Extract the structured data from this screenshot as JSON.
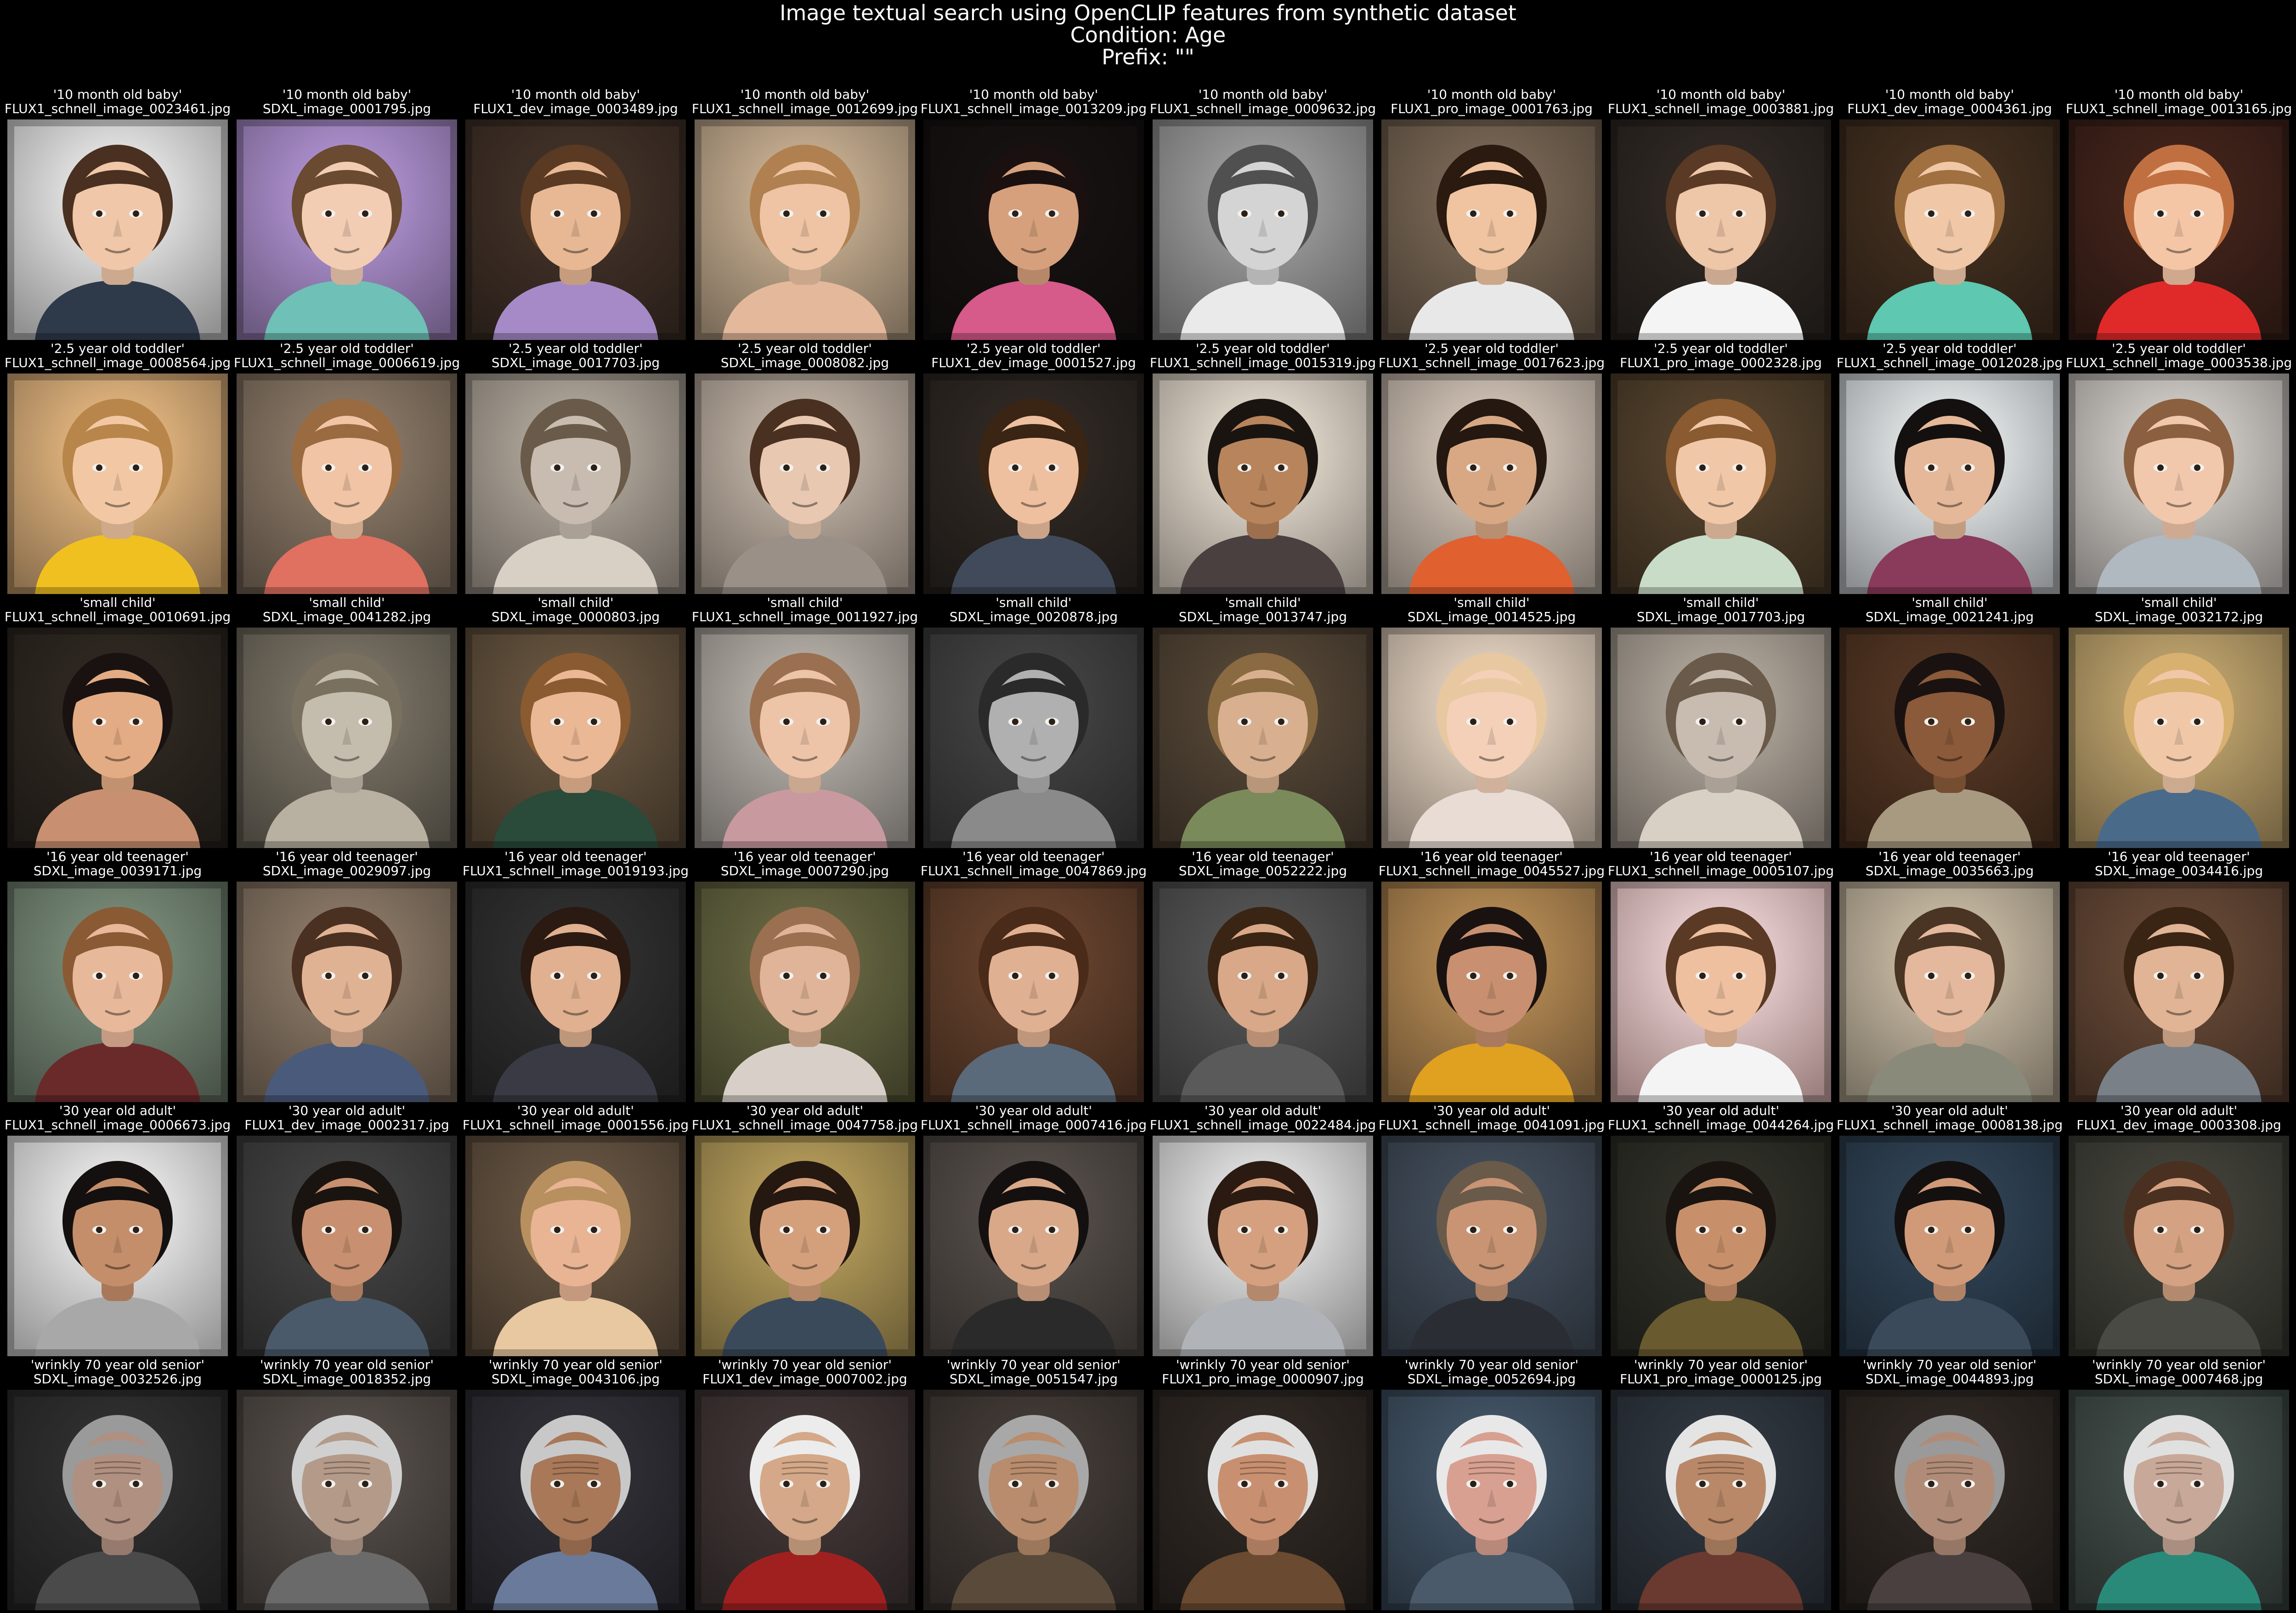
{
  "figure": {
    "title_lines": [
      "Image textual search using OpenCLIP features from synthetic dataset",
      "Condition: Age",
      "Prefix: \"\""
    ]
  },
  "rows": [
    {
      "query": "'10 month old baby'",
      "images": [
        {
          "file": "FLUX1_schnell_image_0023461.jpg",
          "bg": "#cfcfcf",
          "skin": "#f0c7a8",
          "hair": "#4a3020",
          "cloth": "#2e3a4a"
        },
        {
          "file": "SDXL_image_0001795.jpg",
          "bg": "#9a80b8",
          "skin": "#f2cdb4",
          "hair": "#6a4a30",
          "cloth": "#6fc0b6"
        },
        {
          "file": "FLUX1_dev_image_0003489.jpg",
          "bg": "#3a2c24",
          "skin": "#e8b894",
          "hair": "#5a3a22",
          "cloth": "#a68ac8"
        },
        {
          "file": "FLUX1_schnell_image_0012699.jpg",
          "bg": "#b09a80",
          "skin": "#eec4a4",
          "hair": "#b08050",
          "cloth": "#e4b89a"
        },
        {
          "file": "FLUX1_schnell_image_0013209.jpg",
          "bg": "#141010",
          "skin": "#d6a07c",
          "hair": "#1a1010",
          "cloth": "#d65a8a"
        },
        {
          "file": "FLUX1_schnell_image_0009632.jpg",
          "bg": "#8a8a8a",
          "skin": "#d4d4d4",
          "hair": "#505050",
          "cloth": "#eaeaea"
        },
        {
          "file": "FLUX1_pro_image_0001763.jpg",
          "bg": "#6a5a4a",
          "skin": "#f0c4a0",
          "hair": "#2a1a10",
          "cloth": "#e8e8e8"
        },
        {
          "file": "FLUX1_schnell_image_0003881.jpg",
          "bg": "#2a2420",
          "skin": "#eec6a8",
          "hair": "#5a3a24",
          "cloth": "#f4f4f4"
        },
        {
          "file": "FLUX1_dev_image_0004361.jpg",
          "bg": "#3a2a1c",
          "skin": "#f0c8a8",
          "hair": "#a07040",
          "cloth": "#5ec8b0"
        },
        {
          "file": "FLUX1_schnell_image_0013165.jpg",
          "bg": "#3a2018",
          "skin": "#f4c6a6",
          "hair": "#c07040",
          "cloth": "#e02a2a"
        }
      ]
    },
    {
      "query": "'2.5 year old toddler'",
      "images": [
        {
          "file": "FLUX1_schnell_image_0008564.jpg",
          "bg": "#c8a070",
          "skin": "#f2c8a4",
          "hair": "#b8864a",
          "cloth": "#f0c020"
        },
        {
          "file": "FLUX1_schnell_image_0006619.jpg",
          "bg": "#7a6a5a",
          "skin": "#f0c4a4",
          "hair": "#9a6a40",
          "cloth": "#e07060"
        },
        {
          "file": "SDXL_image_0017703.jpg",
          "bg": "#9a9288",
          "skin": "#c8bcb0",
          "hair": "#6a5a4a",
          "cloth": "#d8d0c4"
        },
        {
          "file": "SDXL_image_0008082.jpg",
          "bg": "#a89c90",
          "skin": "#e8c8b0",
          "hair": "#4a3020",
          "cloth": "#9a9088"
        },
        {
          "file": "FLUX1_dev_image_0001527.jpg",
          "bg": "#2a2420",
          "skin": "#eec0a0",
          "hair": "#3a2414",
          "cloth": "#404a5a"
        },
        {
          "file": "FLUX1_schnell_image_0015319.jpg",
          "bg": "#c8c0b4",
          "skin": "#b8845c",
          "hair": "#1a1410",
          "cloth": "#4a4040"
        },
        {
          "file": "FLUX1_schnell_image_0017623.jpg",
          "bg": "#b8aca0",
          "skin": "#d8a884",
          "hair": "#241810",
          "cloth": "#e06030"
        },
        {
          "file": "FLUX1_pro_image_0002328.jpg",
          "bg": "#4a3a28",
          "skin": "#f0c8a8",
          "hair": "#8a5a30",
          "cloth": "#c8dcc8"
        },
        {
          "file": "FLUX1_schnell_image_0012028.jpg",
          "bg": "#c8ccd0",
          "skin": "#e4b898",
          "hair": "#141010",
          "cloth": "#8a3a5a"
        },
        {
          "file": "FLUX1_schnell_image_0003538.jpg",
          "bg": "#b8b4b0",
          "skin": "#f2c8ac",
          "hair": "#8a6040",
          "cloth": "#b0b8c0"
        }
      ]
    },
    {
      "query": "'small child'",
      "images": [
        {
          "file": "FLUX1_schnell_image_0010691.jpg",
          "bg": "#2a241e",
          "skin": "#e4ac84",
          "hair": "#1a1210",
          "cloth": "#c89070"
        },
        {
          "file": "SDXL_image_0041282.jpg",
          "bg": "#6a6458",
          "skin": "#c4bcac",
          "hair": "#7a7060",
          "cloth": "#b8b0a0"
        },
        {
          "file": "SDXL_image_0000803.jpg",
          "bg": "#5a4a38",
          "skin": "#eab894",
          "hair": "#8a5a30",
          "cloth": "#2a4a3a"
        },
        {
          "file": "FLUX1_schnell_image_0011927.jpg",
          "bg": "#a09a94",
          "skin": "#eec4a8",
          "hair": "#9a7050",
          "cloth": "#c89aa0"
        },
        {
          "file": "SDXL_image_0020878.jpg",
          "bg": "#3a3a3a",
          "skin": "#b0b0b0",
          "hair": "#2a2a2a",
          "cloth": "#8a8a8a"
        },
        {
          "file": "SDXL_image_0013747.jpg",
          "bg": "#4a3e30",
          "skin": "#d8b090",
          "hair": "#8a6a40",
          "cloth": "#7a8a5a"
        },
        {
          "file": "SDXL_image_0014525.jpg",
          "bg": "#c8b8a8",
          "skin": "#f4d0b8",
          "hair": "#e8c8a0",
          "cloth": "#e8dcd4"
        },
        {
          "file": "SDXL_image_0017703.jpg",
          "bg": "#9a9288",
          "skin": "#c8bcb0",
          "hair": "#6a5a4a",
          "cloth": "#d8d0c4"
        },
        {
          "file": "SDXL_image_0021241.jpg",
          "bg": "#4a3020",
          "skin": "#8a5a3a",
          "hair": "#1a1210",
          "cloth": "#a89a80"
        },
        {
          "file": "SDXL_image_0032172.jpg",
          "bg": "#a89060",
          "skin": "#f0c8a8",
          "hair": "#d8b070",
          "cloth": "#4a6a8a"
        }
      ]
    },
    {
      "query": "'16 year old teenager'",
      "images": [
        {
          "file": "SDXL_image_0039171.jpg",
          "bg": "#6a7a6a",
          "skin": "#e8b89a",
          "hair": "#8a5a34",
          "cloth": "#6a2a2a"
        },
        {
          "file": "SDXL_image_0029097.jpg",
          "bg": "#7a6a5a",
          "skin": "#e0b294",
          "hair": "#4a3020",
          "cloth": "#4a5a7a"
        },
        {
          "file": "FLUX1_schnell_image_0019193.jpg",
          "bg": "#2a2a2a",
          "skin": "#e0b090",
          "hair": "#2a1a12",
          "cloth": "#3a3a44"
        },
        {
          "file": "SDXL_image_0007290.jpg",
          "bg": "#5a5a3a",
          "skin": "#e0b498",
          "hair": "#9a7050",
          "cloth": "#d8d0c8"
        },
        {
          "file": "FLUX1_schnell_image_0047869.jpg",
          "bg": "#5a3a28",
          "skin": "#e0b092",
          "hair": "#4a2a18",
          "cloth": "#5a6a7a"
        },
        {
          "file": "SDXL_image_0052222.jpg",
          "bg": "#4a4a4a",
          "skin": "#d8a888",
          "hair": "#3a2414",
          "cloth": "#5a5a5a"
        },
        {
          "file": "FLUX1_schnell_image_0045527.jpg",
          "bg": "#a07a4a",
          "skin": "#c89070",
          "hair": "#1a1210",
          "cloth": "#e0a020"
        },
        {
          "file": "FLUX1_schnell_image_0005107.jpg",
          "bg": "#e0b8b8",
          "skin": "#eec0a0",
          "hair": "#5a3a24",
          "cloth": "#f4f4f4"
        },
        {
          "file": "SDXL_image_0035663.jpg",
          "bg": "#b0a490",
          "skin": "#e4b89c",
          "hair": "#4a3424",
          "cloth": "#8a8a7a"
        },
        {
          "file": "SDXL_image_0034416.jpg",
          "bg": "#5a4030",
          "skin": "#e0b494",
          "hair": "#3a2414",
          "cloth": "#7a8088"
        }
      ]
    },
    {
      "query": "'30 year old adult'",
      "images": [
        {
          "file": "FLUX1_schnell_image_0006673.jpg",
          "bg": "#d8d8d8",
          "skin": "#c48e6a",
          "hair": "#141010",
          "cloth": "#a8a8a8"
        },
        {
          "file": "FLUX1_dev_image_0002317.jpg",
          "bg": "#3a3a3a",
          "skin": "#c89070",
          "hair": "#1a1410",
          "cloth": "#4a5a6a"
        },
        {
          "file": "FLUX1_schnell_image_0001556.jpg",
          "bg": "#5a4a3a",
          "skin": "#e8b494",
          "hair": "#b89060",
          "cloth": "#e8c8a0"
        },
        {
          "file": "FLUX1_schnell_image_0047758.jpg",
          "bg": "#a08a50",
          "skin": "#d4a07c",
          "hair": "#241810",
          "cloth": "#3a4a5a"
        },
        {
          "file": "FLUX1_schnell_image_0007416.jpg",
          "bg": "#4a4440",
          "skin": "#d8a888",
          "hair": "#141010",
          "cloth": "#2a2a2a"
        },
        {
          "file": "FLUX1_schnell_image_0022484.jpg",
          "bg": "#c8c8c8",
          "skin": "#d4a080",
          "hair": "#2a1a12",
          "cloth": "#b0b4b8"
        },
        {
          "file": "FLUX1_schnell_image_0041091.jpg",
          "bg": "#3a4450",
          "skin": "#c89474",
          "hair": "#6a5a4a",
          "cloth": "#2a2e34"
        },
        {
          "file": "FLUX1_schnell_image_0044264.jpg",
          "bg": "#2a2a24",
          "skin": "#c8906a",
          "hair": "#1a1410",
          "cloth": "#6a5a30"
        },
        {
          "file": "FLUX1_schnell_image_0008138.jpg",
          "bg": "#2a3a4a",
          "skin": "#d09a78",
          "hair": "#141010",
          "cloth": "#3a4a5a"
        },
        {
          "file": "FLUX1_dev_image_0003308.jpg",
          "bg": "#3a3a34",
          "skin": "#d4a282",
          "hair": "#4a3020",
          "cloth": "#4a4a44"
        }
      ]
    },
    {
      "query": "'wrinkly 70 year old senior'",
      "images": [
        {
          "file": "SDXL_image_0032526.jpg",
          "bg": "#2a2a2a",
          "skin": "#b09080",
          "hair": "#9a9a9a",
          "cloth": "#4a4a4a"
        },
        {
          "file": "SDXL_image_0018352.jpg",
          "bg": "#4a4440",
          "skin": "#b49a88",
          "hair": "#d0d0d0",
          "cloth": "#6a6a6a"
        },
        {
          "file": "SDXL_image_0043106.jpg",
          "bg": "#2a2a30",
          "skin": "#a87858",
          "hair": "#c8c8c8",
          "cloth": "#6a7a9a"
        },
        {
          "file": "FLUX1_dev_image_0007002.jpg",
          "bg": "#3a3030",
          "skin": "#d4a888",
          "hair": "#ececec",
          "cloth": "#a02020"
        },
        {
          "file": "SDXL_image_0051547.jpg",
          "bg": "#3a3430",
          "skin": "#b88c6c",
          "hair": "#a8a8a8",
          "cloth": "#5a4a3a"
        },
        {
          "file": "FLUX1_pro_image_0000907.jpg",
          "bg": "#2a2420",
          "skin": "#c89070",
          "hair": "#e0e0e0",
          "cloth": "#6a4a30"
        },
        {
          "file": "SDXL_image_0052694.jpg",
          "bg": "#3a4a5a",
          "skin": "#d8a090",
          "hair": "#e8e8e8",
          "cloth": "#4a5a6a"
        },
        {
          "file": "FLUX1_pro_image_0000125.jpg",
          "bg": "#2a3038",
          "skin": "#b88868",
          "hair": "#e4e4e4",
          "cloth": "#6a3a30"
        },
        {
          "file": "SDXL_image_0044893.jpg",
          "bg": "#2a2420",
          "skin": "#b08c78",
          "hair": "#9a9a9a",
          "cloth": "#4a4040"
        },
        {
          "file": "SDXL_image_0007468.jpg",
          "bg": "#3a4440",
          "skin": "#c8a898",
          "hair": "#e0e0e0",
          "cloth": "#2a8a7a"
        }
      ]
    }
  ]
}
